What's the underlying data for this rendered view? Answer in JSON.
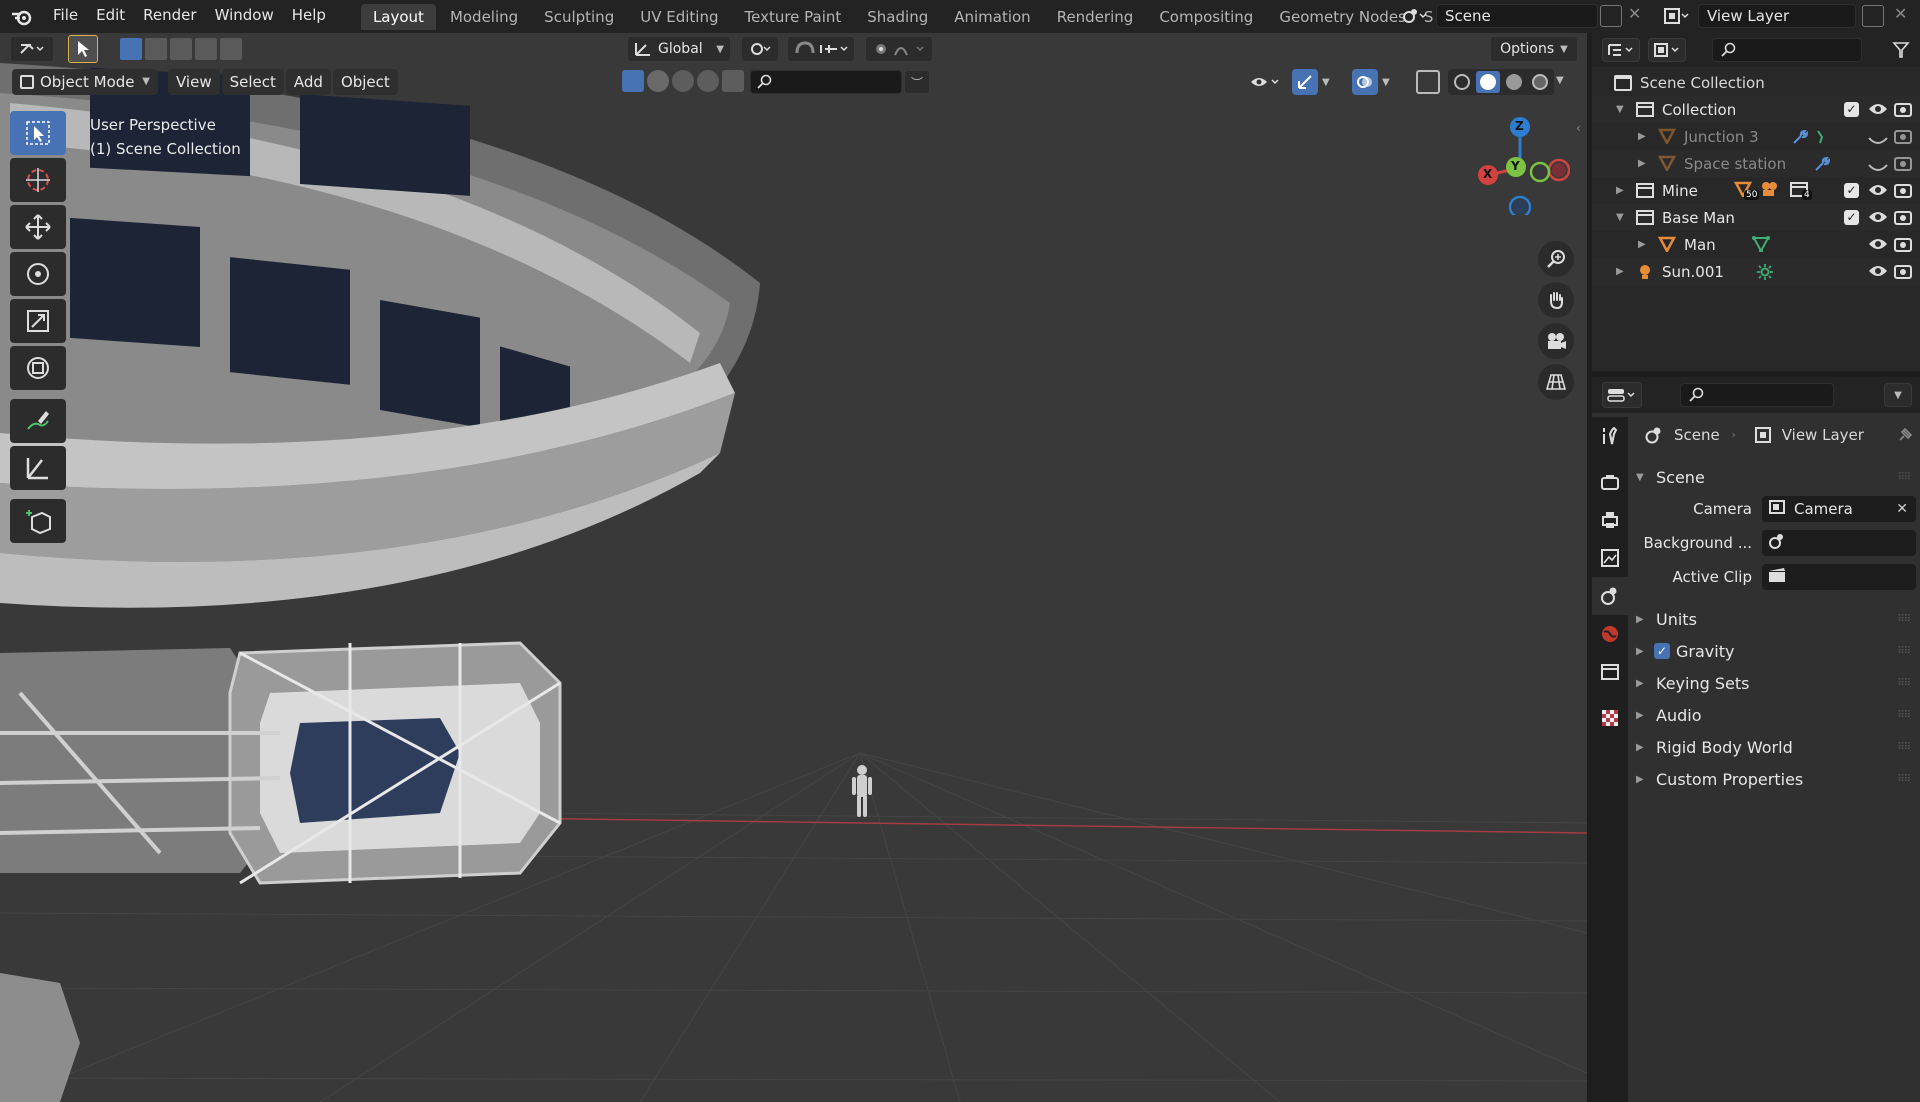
{
  "app": {
    "menus": [
      "File",
      "Edit",
      "Render",
      "Window",
      "Help"
    ]
  },
  "workspaces": {
    "tabs": [
      "Layout",
      "Modeling",
      "Sculpting",
      "UV Editing",
      "Texture Paint",
      "Shading",
      "Animation",
      "Rendering",
      "Compositing",
      "Geometry Nodes",
      "S"
    ],
    "active": "Layout"
  },
  "scene_selector": {
    "value": "Scene"
  },
  "view_layer_selector": {
    "value": "View Layer"
  },
  "viewport": {
    "mode": "Object Mode",
    "menus": [
      "View",
      "Select",
      "Add",
      "Object"
    ],
    "transform_orientation": "Global",
    "options": "Options",
    "overlay_text": [
      "User Perspective",
      "(1) Scene Collection"
    ],
    "gizmo_axes": [
      "Z",
      "X",
      "Y"
    ]
  },
  "outliner": {
    "root": "Scene Collection",
    "rows": [
      {
        "label": "Collection",
        "depth": 1,
        "expanded": true,
        "icon": "collection-icon",
        "checked": true,
        "visible": true,
        "dim": false
      },
      {
        "label": "Junction 3",
        "depth": 2,
        "expanded": false,
        "icon": "mesh-icon",
        "checked": false,
        "visible": false,
        "dim": true
      },
      {
        "label": "Space station",
        "depth": 2,
        "expanded": false,
        "icon": "mesh-icon",
        "checked": false,
        "visible": false,
        "dim": true
      },
      {
        "label": "Mine",
        "depth": 1,
        "expanded": false,
        "icon": "collection-icon",
        "checked": true,
        "visible": true,
        "dim": false,
        "badges": [
          "50",
          "4"
        ]
      },
      {
        "label": "Base Man",
        "depth": 1,
        "expanded": true,
        "icon": "collection-icon",
        "checked": true,
        "visible": true,
        "dim": false
      },
      {
        "label": "Man",
        "depth": 2,
        "expanded": false,
        "icon": "mesh-icon",
        "checked": false,
        "visible": true,
        "dim": false
      },
      {
        "label": "Sun.001",
        "depth": 1,
        "expanded": false,
        "icon": "light-icon",
        "checked": false,
        "visible": true,
        "dim": false
      }
    ]
  },
  "properties": {
    "breadcrumb": [
      "Scene",
      "View Layer"
    ],
    "panel_title": "Scene",
    "fields": [
      {
        "label": "Camera",
        "value": "Camera"
      },
      {
        "label": "Background ...",
        "value": ""
      },
      {
        "label": "Active Clip",
        "value": ""
      }
    ],
    "subpanels": [
      {
        "label": "Units",
        "checkbox": false
      },
      {
        "label": "Gravity",
        "checkbox": true
      },
      {
        "label": "Keying Sets",
        "checkbox": false
      },
      {
        "label": "Audio",
        "checkbox": false
      },
      {
        "label": "Rigid Body World",
        "checkbox": false
      },
      {
        "label": "Custom Properties",
        "checkbox": false
      }
    ]
  }
}
